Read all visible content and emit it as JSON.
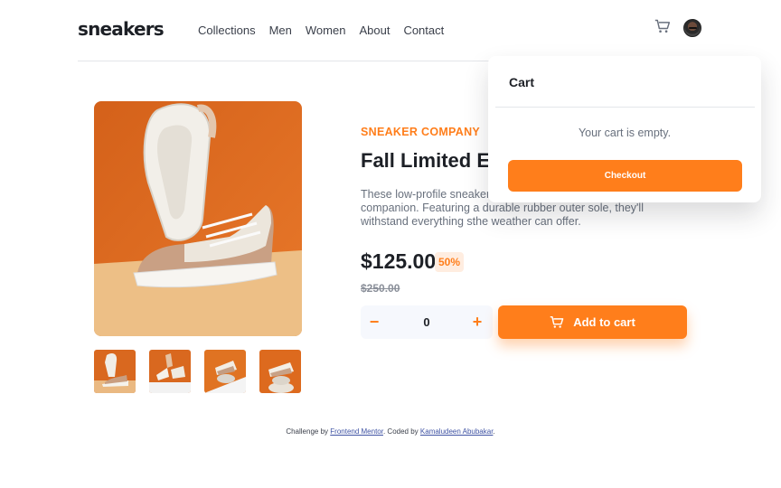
{
  "brand": {
    "logo_text": "sneakers"
  },
  "nav": {
    "items": [
      "Collections",
      "Men",
      "Women",
      "About",
      "Contact"
    ]
  },
  "header_icons": {
    "cart": "cart-icon",
    "avatar": "user-avatar"
  },
  "product": {
    "company": "SNEAKER COMPANY",
    "title": "Fall Limited Edition Sneakers",
    "description": "These low-profile sneakers are your perfect casual wear companion. Featuring a durable rubber outer sole, they'll withstand everything sthe weather can offer.",
    "price": "$125.00",
    "discount": "50%",
    "original_price": "$250.00",
    "quantity": "0",
    "quantity_minus": "−",
    "quantity_plus": "+",
    "add_to_cart_label": "Add to cart"
  },
  "gallery": {
    "thumbnail_count": 4
  },
  "cart": {
    "title": "Cart",
    "empty_message": "Your cart is empty.",
    "checkout_label": "Checkout"
  },
  "footer": {
    "challenge_prefix": "Challenge by",
    "challenge_link": "Frontend Mentor",
    "coded_prefix": ". Coded by",
    "coded_link": "Kamaludeen Abubakar",
    "suffix": "."
  },
  "colors": {
    "accent": "#ff7e1b",
    "accent_pale": "#ffede0",
    "text_dark": "#1d2026",
    "text_muted": "#68707d",
    "link": "#3e52a3"
  }
}
